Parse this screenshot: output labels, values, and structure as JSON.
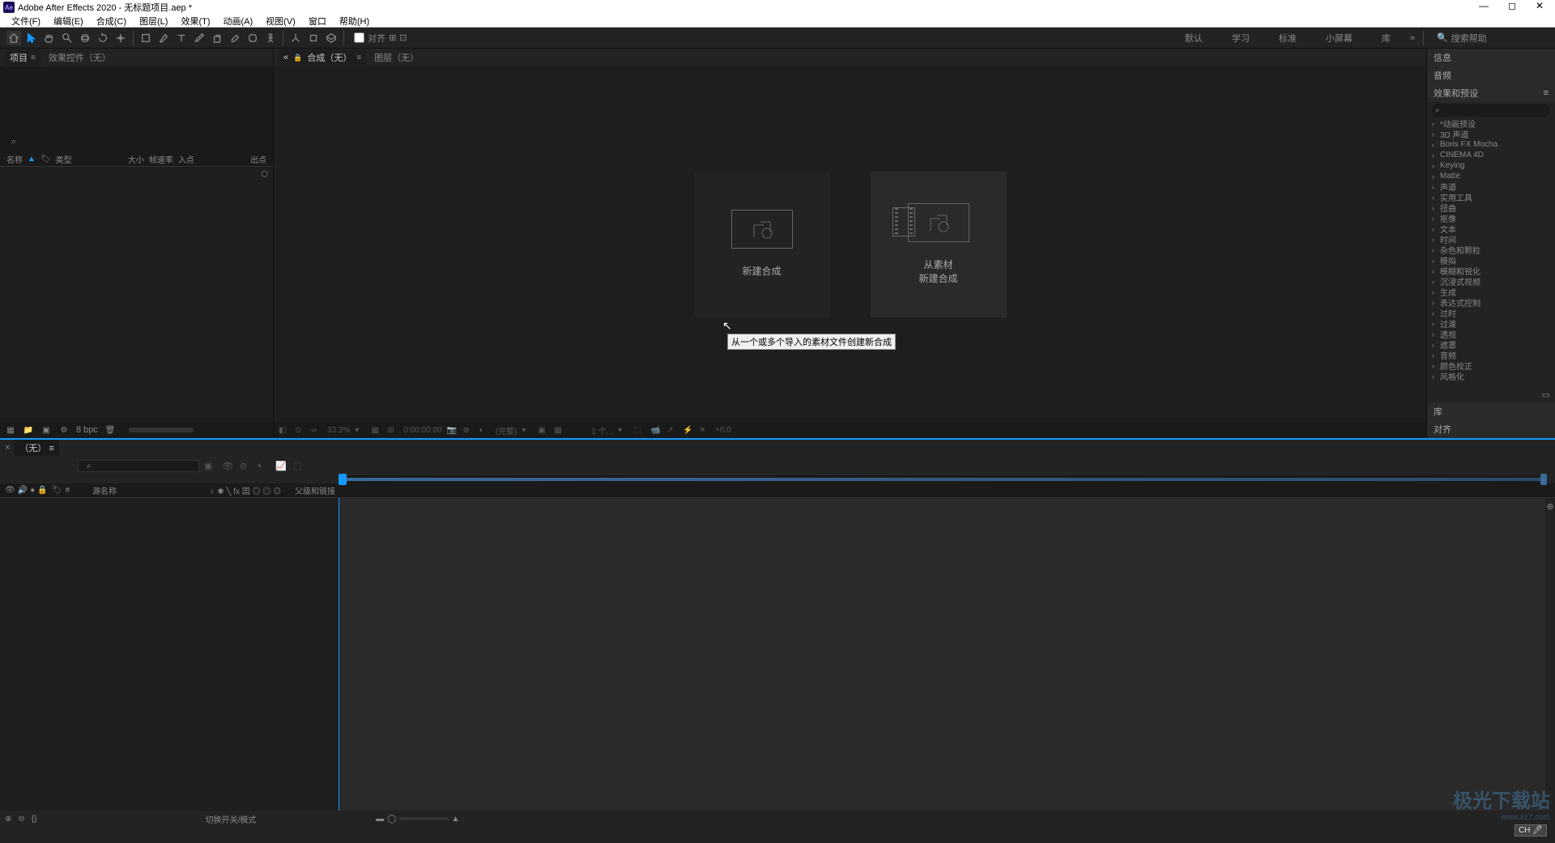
{
  "title": "Adobe After Effects 2020 - 无标题项目.aep *",
  "menus": [
    "文件(F)",
    "编辑(E)",
    "合成(C)",
    "图层(L)",
    "效果(T)",
    "动画(A)",
    "视图(V)",
    "窗口",
    "帮助(H)"
  ],
  "toolbar": {
    "align_label": "对齐"
  },
  "workspaces": [
    "默认",
    "学习",
    "标准",
    "小屏幕",
    "库"
  ],
  "search_help": {
    "placeholder": "搜索帮助"
  },
  "project_panel": {
    "tabs": {
      "project": "项目",
      "effect_controls": "效果控件（无）"
    },
    "search_placeholder": "",
    "headers": {
      "name": "名称",
      "type": "类型",
      "size": "大小",
      "fps": "帧速率",
      "in": "入点",
      "out": "出点"
    },
    "bpc": "8 bpc"
  },
  "comp_panel": {
    "tabs": {
      "comp": "合成（无）",
      "layer": "图层（无）"
    },
    "new_comp": "新建合成",
    "from_footage": "从素材\n新建合成",
    "tooltip": "从一个或多个导入的素材文件创建新合成",
    "footer": {
      "zoom": "33.3%",
      "time": "0:00:00:00",
      "quality": "(完整)",
      "one": "1 个...",
      "plus0": "+0.0"
    }
  },
  "right": {
    "info": "信息",
    "audio": "音频",
    "effects_presets": "效果和预设",
    "search_placeholder": "",
    "items": [
      "*动画预设",
      "3D 声道",
      "Boris FX Mocha",
      "CINEMA 4D",
      "Keying",
      "Matte",
      "声道",
      "实用工具",
      "扭曲",
      "抠像",
      "文本",
      "时间",
      "杂色和颗粒",
      "模拟",
      "模糊和锐化",
      "沉浸式视频",
      "生成",
      "表达式控制",
      "过时",
      "过渡",
      "透视",
      "遮罩",
      "音频",
      "颜色校正",
      "风格化"
    ],
    "library": "库",
    "align": "对齐"
  },
  "timeline": {
    "tab": "（无）",
    "cols": {
      "source": "源名称",
      "switches": "♀ ✱ ╲ fx 囯 ◎ ◎ ⊙",
      "parent": "父级和链接"
    },
    "footer_mode": "切换开关/模式"
  },
  "watermark": {
    "logo": "极光下载站",
    "url": "www.xz7.com"
  },
  "ime": "CH 🖊"
}
